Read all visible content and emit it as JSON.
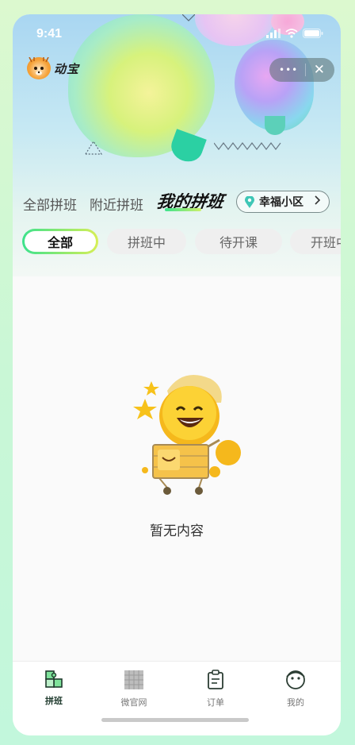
{
  "status_bar": {
    "time": "9:41"
  },
  "app": {
    "name": "动宝"
  },
  "capsule": {
    "more": "•••",
    "close": "✕"
  },
  "tabs": [
    {
      "label": "全部拼班",
      "active": false
    },
    {
      "label": "附近拼班",
      "active": false
    },
    {
      "label": "我的拼班",
      "active": true
    }
  ],
  "location": {
    "label": "幸福小区"
  },
  "filters": [
    {
      "label": "全部",
      "active": true
    },
    {
      "label": "拼班中",
      "active": false
    },
    {
      "label": "待开课",
      "active": false
    },
    {
      "label": "开班中",
      "active": false
    }
  ],
  "empty_state": {
    "text": "暂无内容"
  },
  "tabbar": [
    {
      "label": "拼班",
      "icon": "puzzle-icon",
      "active": true
    },
    {
      "label": "微官网",
      "icon": "grid-image-icon",
      "active": false
    },
    {
      "label": "订单",
      "icon": "clipboard-icon",
      "active": false
    },
    {
      "label": "我的",
      "icon": "face-icon",
      "active": false
    }
  ],
  "colors": {
    "accent_green": "#3ce28c",
    "accent_yellow": "#d7ef56",
    "tabbar_active": "#1f3a2d"
  }
}
